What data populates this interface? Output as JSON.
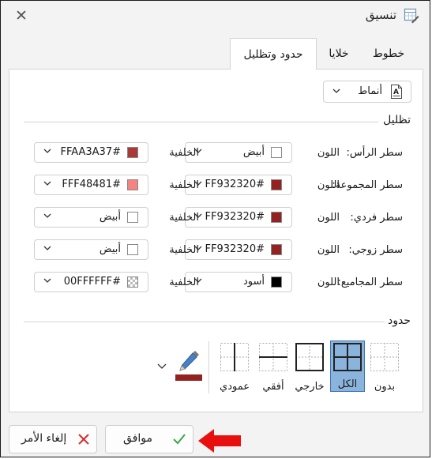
{
  "window": {
    "title": "تنسيق",
    "close_glyph": "✕"
  },
  "tabs": [
    {
      "label": "خطوط",
      "active": false
    },
    {
      "label": "خلايا",
      "active": false
    },
    {
      "label": "حدود وتظليل",
      "active": true
    }
  ],
  "styles_dropdown": {
    "label": "أنماط"
  },
  "shading": {
    "title": "تظليل",
    "color_label": "اللون",
    "background_label": "الخلفية",
    "rows": [
      {
        "label": "سطر الرأس:",
        "color": {
          "value": "أبيض",
          "swatch": "#ffffff"
        },
        "background": {
          "value": "FFAA3A37#",
          "swatch": "#aa3a37"
        }
      },
      {
        "label": "سطر المجموعة:",
        "color": {
          "value": "FF932320#",
          "swatch": "#932320"
        },
        "background": {
          "value": "FFF48481#",
          "swatch": "#f48481"
        }
      },
      {
        "label": "سطر فردي:",
        "color": {
          "value": "FF932320#",
          "swatch": "#932320"
        },
        "background": {
          "value": "أبيض",
          "swatch": "#ffffff"
        }
      },
      {
        "label": "سطر زوجي:",
        "color": {
          "value": "FF932320#",
          "swatch": "#932320"
        },
        "background": {
          "value": "أبيض",
          "swatch": "#ffffff"
        }
      },
      {
        "label": "سطر المجاميع:",
        "color": {
          "value": "أسود",
          "swatch": "#000000"
        },
        "background": {
          "value": "00FFFFFF#",
          "swatch": "transparent"
        }
      }
    ]
  },
  "borders": {
    "title": "حدود",
    "options": [
      {
        "label": "بدون",
        "icon": "border-none-icon",
        "selected": false
      },
      {
        "label": "الكل",
        "icon": "border-all-icon",
        "selected": true
      },
      {
        "label": "خارجي",
        "icon": "border-outside-icon",
        "selected": false
      },
      {
        "label": "أفقي",
        "icon": "border-horizontal-icon",
        "selected": false
      },
      {
        "label": "عمودي",
        "icon": "border-vertical-icon",
        "selected": false
      }
    ],
    "line_color": "#932320"
  },
  "footer": {
    "ok_label": "موافق",
    "cancel_label": "إلغاء الأمر"
  },
  "colors": {
    "accent": "#8bb4dd",
    "accent_border": "#3b75b5",
    "annotation_arrow": "#e8100f"
  }
}
